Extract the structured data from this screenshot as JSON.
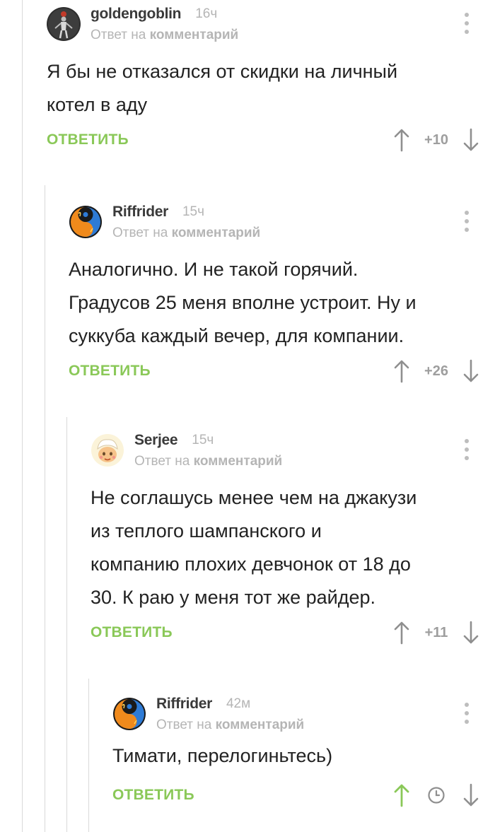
{
  "labels": {
    "reply_to": "Ответ на",
    "reply_to_target": "комментарий",
    "reply_button": "ОТВЕТИТЬ"
  },
  "colors": {
    "accent_green": "#8ac858",
    "muted_gray": "#b5b5b5",
    "text": "#222222"
  },
  "comments": [
    {
      "author": "goldengoblin",
      "time": "16ч",
      "avatar_icon": "dark-figure-avatar-icon",
      "lines": [
        "Я бы не отказался от скидки на личный",
        "котел в аду"
      ],
      "score": "+10",
      "upvoted": false
    },
    {
      "author": "Riffrider",
      "time": "15ч",
      "avatar_icon": "yin-yang-fire-water-avatar-icon",
      "lines": [
        "Аналогично. И не такой горячий.",
        "Градусов 25 меня вполне устроит. Ну и",
        "суккуба каждый вечер, для компании."
      ],
      "score": "+26",
      "upvoted": false
    },
    {
      "author": "Serjee",
      "time": "15ч",
      "avatar_icon": "cartoon-face-avatar-icon",
      "lines": [
        "Не соглашусь менее чем на джакузи",
        "из теплого шампанского и",
        "компанию плохих девчонок от 18 до",
        "30. К раю у меня тот же райдер."
      ],
      "score": "+11",
      "upvoted": false
    },
    {
      "author": "Riffrider",
      "time": "42м",
      "avatar_icon": "yin-yang-fire-water-avatar-icon",
      "lines": [
        "Тимати, перелогиньтесь)"
      ],
      "score": "",
      "score_icon": "clock-icon",
      "upvoted": true
    }
  ]
}
